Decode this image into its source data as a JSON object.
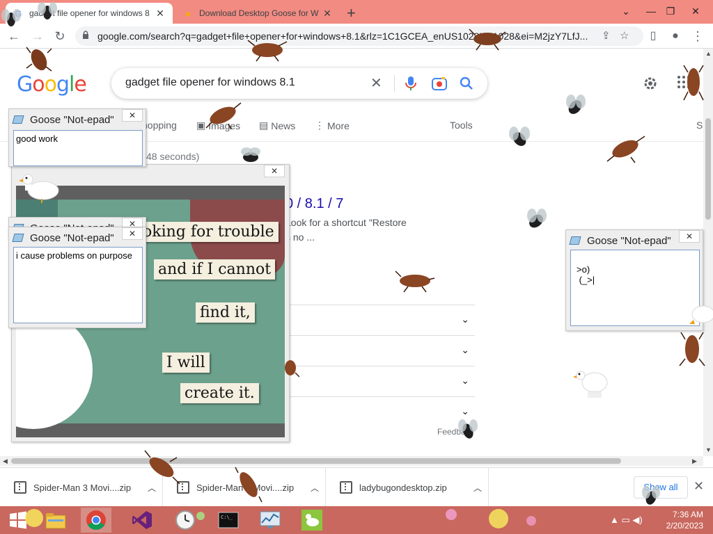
{
  "browser": {
    "tabs": [
      {
        "title": "gadget file opener for windows 8",
        "favicon": "G",
        "close": "✕"
      },
      {
        "title": "Download Desktop Goose for W",
        "favicon": "●",
        "close": "✕"
      }
    ],
    "new_tab": "+",
    "window_controls": {
      "menu": "⌄",
      "minimize": "—",
      "restore": "❐",
      "close": "✕"
    },
    "nav": {
      "back": "←",
      "forward": "→",
      "reload": "↻"
    },
    "url": "google.com/search?q=gadget+file+opener+for+windows+8.1&rlz=1C1GCEA_enUS1028US1028&ei=M2jzY7LfJ...",
    "omnibox_icons": {
      "share": "⇪",
      "star": "☆",
      "sidepanel": "▯",
      "profile": "●",
      "menu": "⋮"
    }
  },
  "google": {
    "logo": [
      {
        "ch": "G",
        "color": "#4285f4"
      },
      {
        "ch": "o",
        "color": "#ea4335"
      },
      {
        "ch": "o",
        "color": "#fbbc05"
      },
      {
        "ch": "g",
        "color": "#4285f4"
      },
      {
        "ch": "l",
        "color": "#34a853"
      },
      {
        "ch": "e",
        "color": "#ea4335"
      }
    ],
    "query": "gadget file opener for windows 8.1",
    "clear_icon": "✕",
    "tabs": [
      {
        "label": "hopping",
        "icon": ""
      },
      {
        "label": "Images",
        "icon": "▣"
      },
      {
        "label": "News",
        "icon": "▤"
      },
      {
        "label": "More",
        "icon": "⋮"
      },
      {
        "label": "Tools",
        "icon": ""
      },
      {
        "label": "S",
        "icon": ""
      }
    ],
    "stats": "48 seconds)",
    "result_heading": "0 / 8.1 / 7",
    "result_snippet_1": "Look for a shortcut \"Restore",
    "result_snippet_2": "s no ...",
    "paa_chevron": "⌄",
    "feedback": "Feedba"
  },
  "downloads": {
    "items": [
      {
        "name": "Spider-Man 3 Movi....zip"
      },
      {
        "name": "Spider-Man 3 Movi....zip"
      },
      {
        "name": "ladybugondesktop.zip"
      }
    ],
    "chevron": "︿",
    "show_all": "Show all",
    "close": "✕"
  },
  "goose_windows": {
    "win1": {
      "title": "Goose \"Not-epad\"",
      "text": "good work"
    },
    "win2": {
      "title": "Goose \"Not-epad\"",
      "text": "i cause problems on purpose"
    },
    "win2_behind_title": "Goose \"Not-epad\"",
    "win3": {
      "title": "Goose \"Not-epad\"",
      "text": ">o)\n (_>|"
    },
    "close": "✕"
  },
  "meme": {
    "lines": [
      "oking for trouble",
      "and if I cannot",
      "find it,",
      "I will",
      "create it."
    ]
  },
  "taskbar": {
    "tray_icons": "▲  ▭  ◀)",
    "time": "7:36 AM",
    "date": "2/20/2023"
  },
  "colors": {
    "tabstrip": "#f28b82",
    "taskbar": "#c9685e",
    "link": "#1a0dab",
    "accent": "#1a73e8"
  }
}
